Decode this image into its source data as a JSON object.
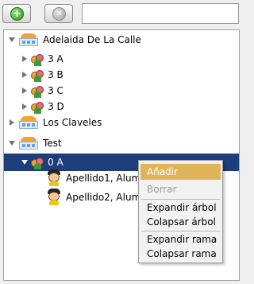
{
  "toolbar": {
    "add_icon": "plus-circle-icon",
    "delete_icon": "x-circle-icon",
    "search_value": ""
  },
  "tree": {
    "schools": [
      {
        "name": "Adelaida De La Calle",
        "groups": [
          "3 A",
          "3 B",
          "3 C",
          "3 D"
        ]
      },
      {
        "name": "Los Claveles"
      },
      {
        "name": "Test",
        "groups": [
          "0 A"
        ],
        "students": [
          "Apellido1, Alumno1",
          "Apellido2, Alumno2"
        ]
      }
    ]
  },
  "context_menu": {
    "items": [
      "Añadir",
      "Borrar",
      "Expandir árbol",
      "Colapsar árbol",
      "Expandir rama",
      "Colapsar rama"
    ]
  },
  "colors": {
    "selection": "#1e3d7b",
    "menu_highlight": "#e0b55a"
  }
}
